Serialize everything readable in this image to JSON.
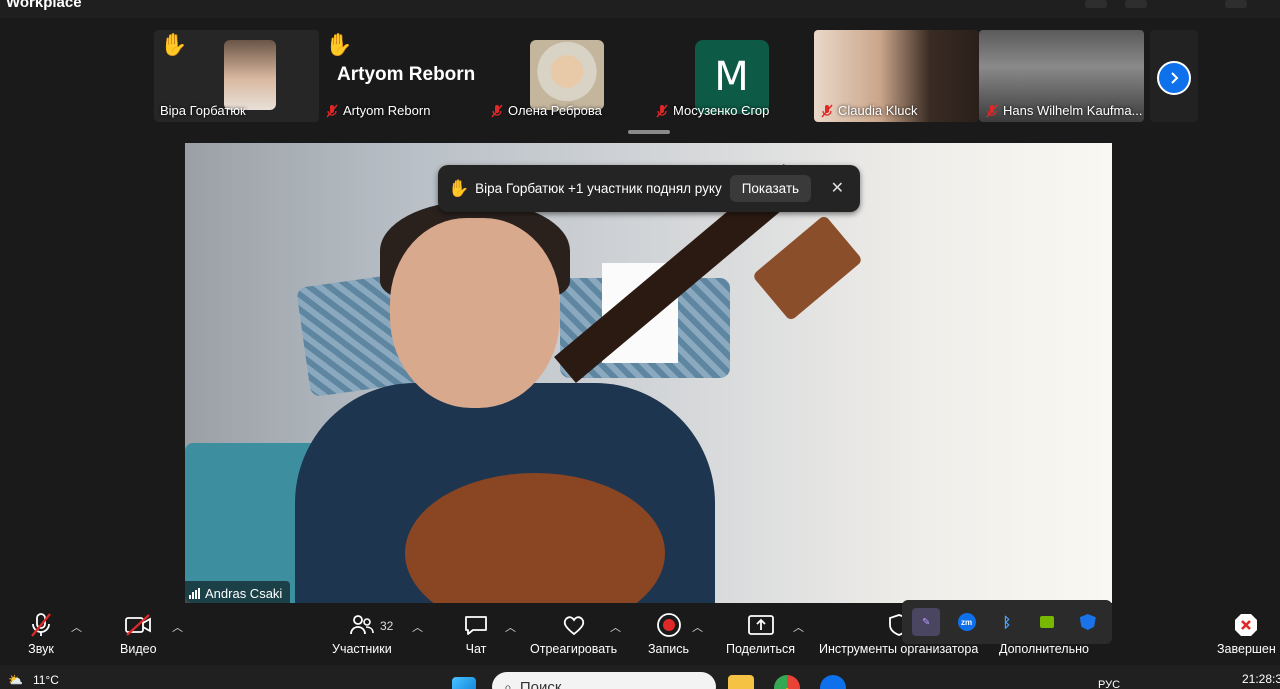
{
  "window": {
    "title": "Workplace"
  },
  "participants_strip": [
    {
      "name": "Віра Горбатюк",
      "hand_raised": true,
      "muted": false
    },
    {
      "name": "Artyom Reborn",
      "display_title": "Artyom Reborn",
      "hand_raised": true,
      "muted": true
    },
    {
      "name": "Олена Реброва",
      "hand_raised": false,
      "muted": true
    },
    {
      "name": "Мосузенко Єгор",
      "avatar_letter": "M",
      "hand_raised": false,
      "muted": true
    },
    {
      "name": "Claudia Kluck",
      "hand_raised": false,
      "muted": true
    },
    {
      "name": "Hans Wilhelm Kaufma...",
      "hand_raised": false,
      "muted": true
    }
  ],
  "active_speaker": {
    "name": "Andras Csaki"
  },
  "notification": {
    "text": "Віра Горбатюк +1 участник поднял руку",
    "button_label": "Показать",
    "close_glyph": "✕"
  },
  "toolbar": {
    "audio_label": "Звук",
    "video_label": "Видео",
    "participants_label": "Участники",
    "participants_count": "32",
    "chat_label": "Чат",
    "react_label": "Отреагировать",
    "record_label": "Запись",
    "share_label": "Поделиться",
    "host_tools_label": "Инструменты организатора",
    "more_label": "Дополнительно",
    "end_label": "Завершен"
  },
  "taskbar": {
    "temperature": "11°C",
    "search_placeholder": "Поиск",
    "language": "РУС",
    "clock": "21:28:3"
  },
  "colors": {
    "accent_blue": "#0e71eb",
    "record_red": "#e02828",
    "mute_red": "#e02828",
    "avatar_green": "#0d5a46"
  }
}
